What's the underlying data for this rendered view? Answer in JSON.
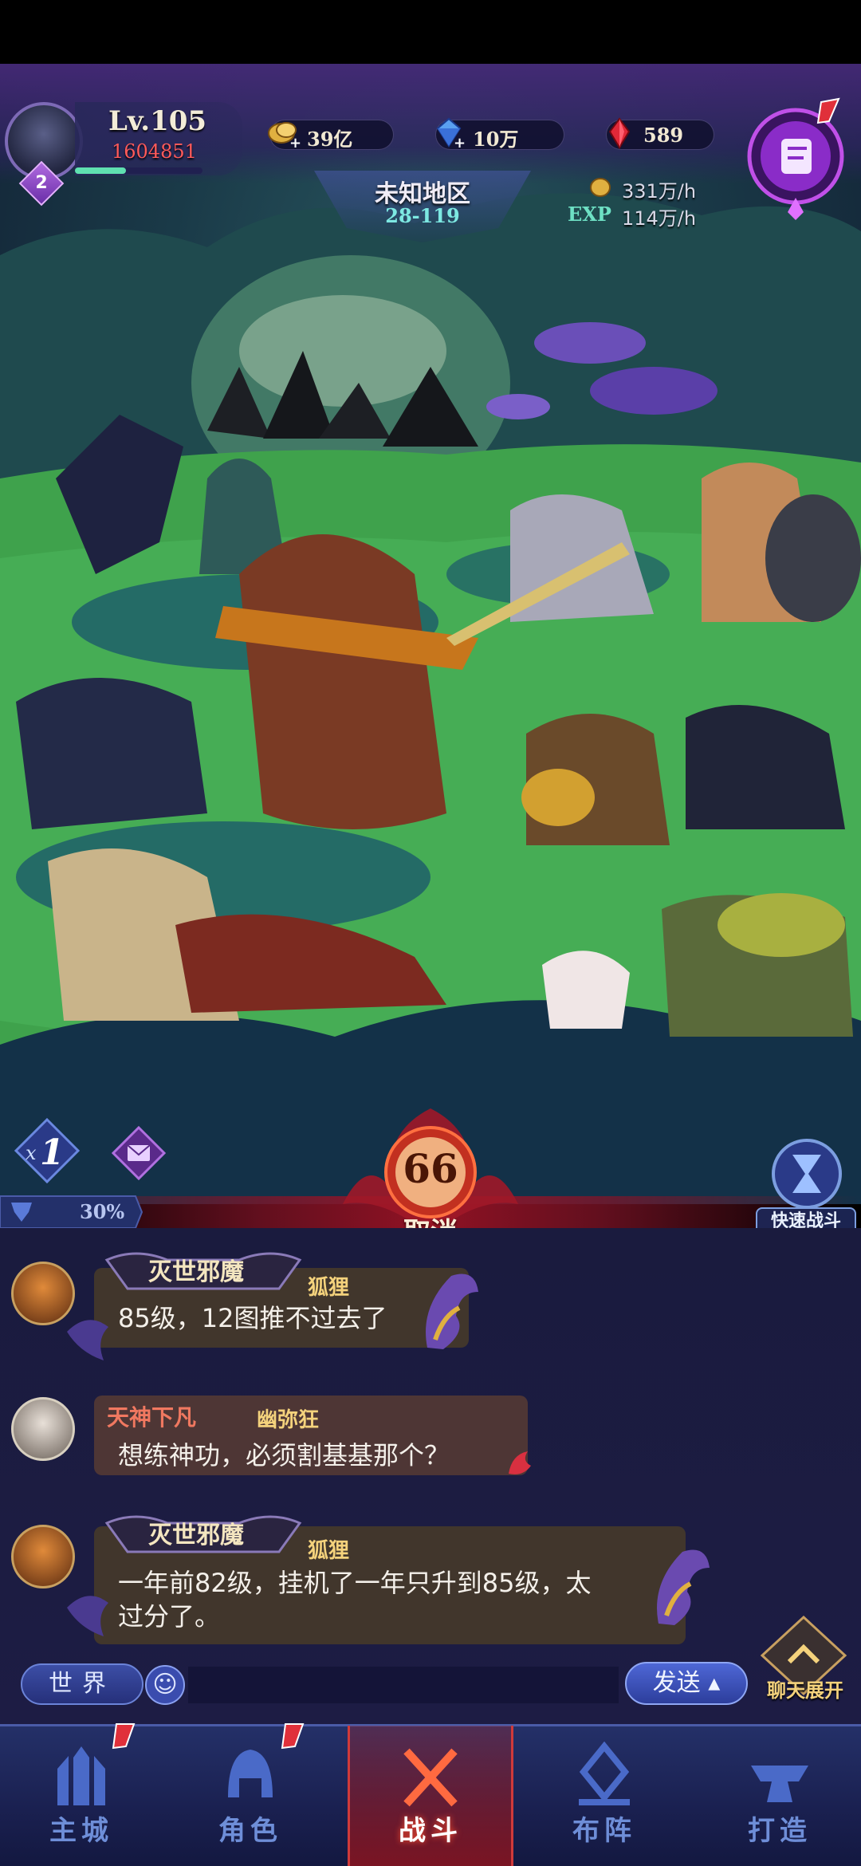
{
  "player": {
    "level": "Lv.105",
    "power": "1604851",
    "badge_number": "2",
    "exp_fraction": 0.4
  },
  "currencies": {
    "gold": "39亿",
    "diamond": "10万",
    "ruby": "589"
  },
  "area": {
    "name": "未知地区",
    "stage": "28-119"
  },
  "idle_rates": {
    "gold": "331万/h",
    "exp_label": "EXP",
    "exp": "114万/h"
  },
  "battle": {
    "speed": "1",
    "speed_prefix": "x",
    "buff_percent": "30%",
    "countdown": "66",
    "cancel_label": "取消",
    "quick_battle_label": "快速战斗"
  },
  "chat": {
    "messages": [
      {
        "title": "灭世邪魔",
        "name": "狐狸",
        "text": "85级，12图推不过去了"
      },
      {
        "title": "天神下凡",
        "name": "幽弥狂",
        "text": "想练神功，必须割基基那个？"
      },
      {
        "title": "灭世邪魔",
        "name": "狐狸",
        "text_line1": "一年前82级，挂机了一年只升到85级，太",
        "text_line2": "过分了。"
      }
    ],
    "channel_label": "世界",
    "send_label": "发送",
    "expand_label": "聊天展开",
    "input_placeholder": ""
  },
  "nav": {
    "items": [
      {
        "label": "主城",
        "icon": "castle-icon",
        "alert": true
      },
      {
        "label": "角色",
        "icon": "helmet-icon",
        "alert": true
      },
      {
        "label": "战斗",
        "icon": "crossed-swords-icon",
        "alert": false,
        "active": true
      },
      {
        "label": "布阵",
        "icon": "formation-icon",
        "alert": false
      },
      {
        "label": "打造",
        "icon": "anvil-icon",
        "alert": false
      }
    ]
  },
  "colors": {
    "accent_purple": "#8a4fd8",
    "alert_red": "#e0303a",
    "chat_gold": "#f4d27c",
    "exp_teal": "#6ee0c4"
  }
}
